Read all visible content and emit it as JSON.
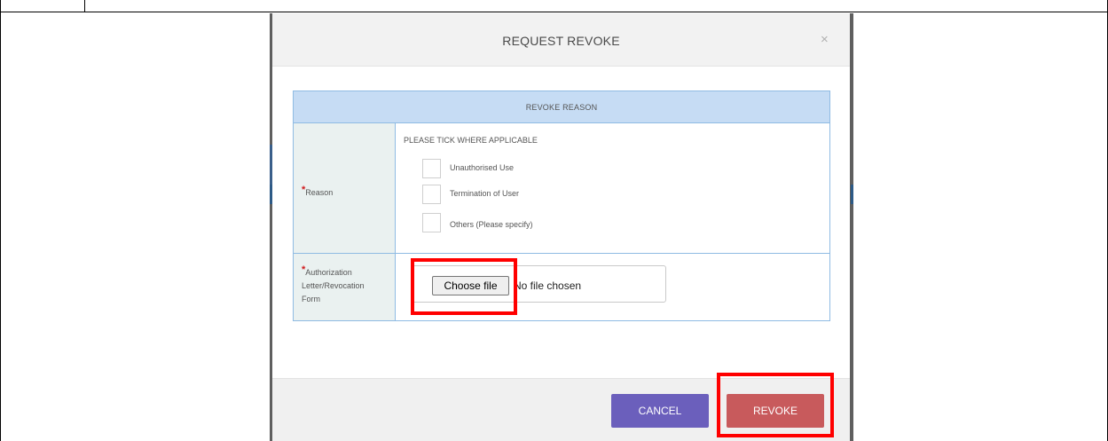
{
  "modal": {
    "title": "REQUEST REVOKE",
    "close_symbol": "×"
  },
  "section": {
    "title": "REVOKE REASON"
  },
  "reason": {
    "label": "Reason",
    "instruction": "PLEASE TICK WHERE APPLICABLE",
    "options": [
      {
        "label": "Unauthorised Use",
        "checked": false
      },
      {
        "label": "Termination of User",
        "checked": false
      },
      {
        "label": "Others (Please specify)",
        "checked": false
      }
    ]
  },
  "authorization": {
    "label_line1": "Authorization",
    "label_line2": "Letter/Revocation",
    "label_line3": "Form",
    "choose_file_label": "Choose file",
    "file_status": "No file chosen"
  },
  "footer": {
    "cancel_label": "CANCEL",
    "revoke_label": "REVOKE"
  },
  "colors": {
    "section_header": "#c6dcf4",
    "cancel": "#6b5fbc",
    "revoke": "#c85a5c",
    "highlight": "#ff0000",
    "required": "#d0191b"
  },
  "icons": {
    "close": "close-icon"
  }
}
